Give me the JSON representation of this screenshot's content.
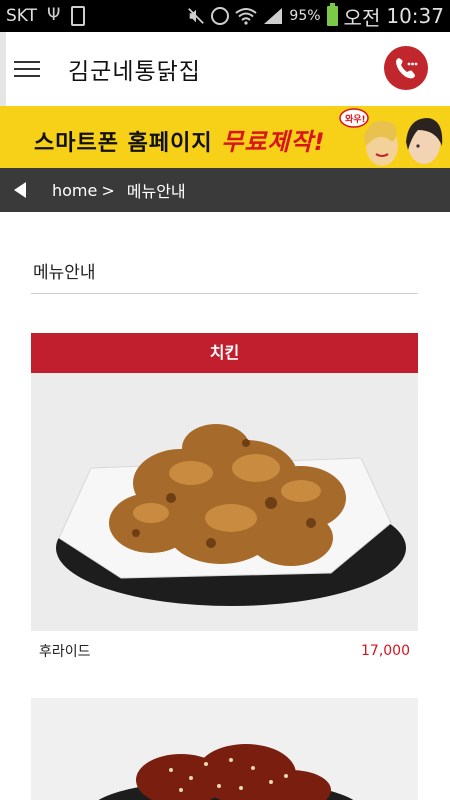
{
  "status_bar": {
    "carrier": "SKT",
    "battery_pct": "95%",
    "ampm": "오전",
    "time": "10:37",
    "battery_color": "#7cc94a"
  },
  "header": {
    "title": "김군네통닭집",
    "call_color": "#c0262b"
  },
  "banner": {
    "text_main": "스마트폰 홈페이지 ",
    "text_highlight": "무료제작!",
    "bubble_text": "와우!",
    "bg_color": "#f7d117"
  },
  "breadcrumb": {
    "home": "home",
    "sep": ">",
    "current": "메뉴안내"
  },
  "page": {
    "section_title": "메뉴안내"
  },
  "menu": {
    "category": "치킨",
    "category_color": "#c11f2e",
    "items": [
      {
        "name": "후라이드",
        "price": "17,000",
        "image": "fried-chicken-photo"
      },
      {
        "name": "",
        "price": "",
        "image": "seasoned-chicken-photo"
      }
    ]
  }
}
